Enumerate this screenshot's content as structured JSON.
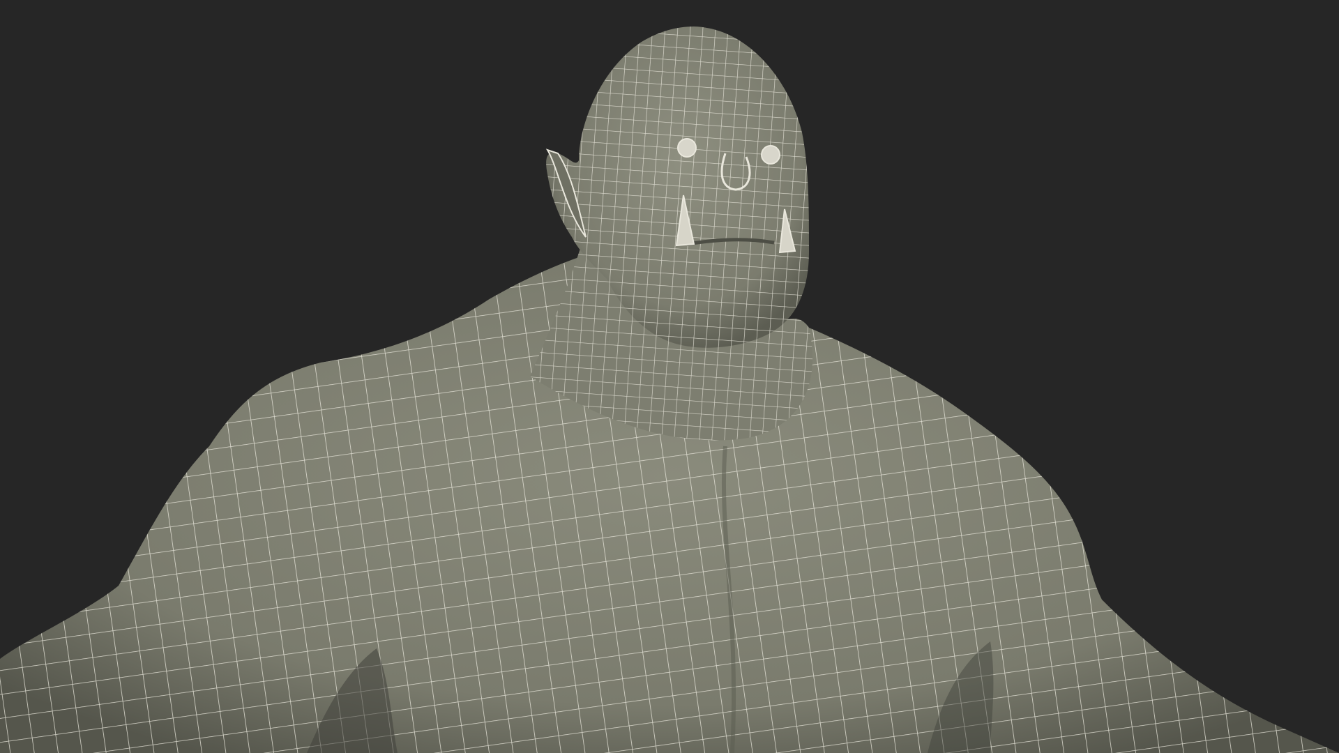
{
  "scene": {
    "subject": "wireframe-orc-bust",
    "colors": {
      "background": "#262626",
      "surface": "#7a7b6d",
      "surface_light": "#8a8b7c",
      "surface_shadow": "#55564c",
      "wire": "#e9e7dc"
    }
  }
}
